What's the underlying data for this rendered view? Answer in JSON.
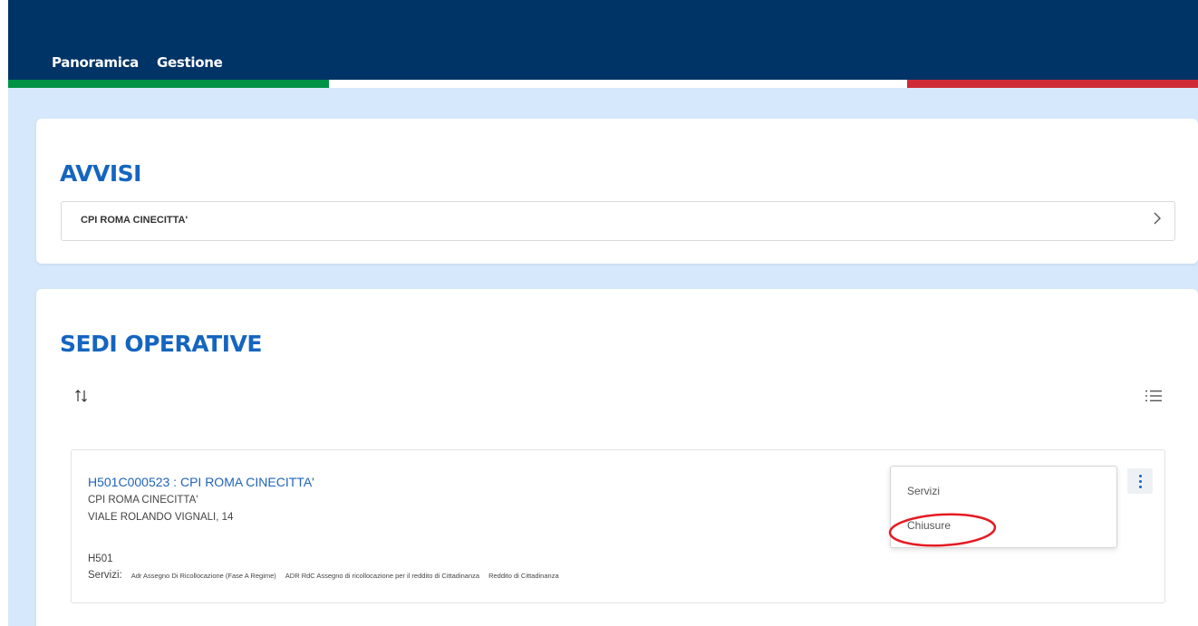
{
  "nav": {
    "items": [
      {
        "label": "Panoramica"
      },
      {
        "label": "Gestione"
      }
    ]
  },
  "colors": {
    "header": "#003366",
    "flag_green": "#009246",
    "flag_white": "#ffffff",
    "flag_red": "#ce2b37",
    "accent": "#1565c0",
    "highlight": "#e41b23"
  },
  "avvisi": {
    "title": "AVVISI",
    "row_label": "CPI ROMA CINECITTA'",
    "row_icon": "chevron-right-icon"
  },
  "sedi": {
    "title": "SEDI OPERATIVE",
    "sort_icon": "sort-icon",
    "view_icon": "list-view-icon",
    "item": {
      "title": "H501C000523 : CPI ROMA CINECITTA'",
      "name": "CPI ROMA CINECITTA'",
      "address": "VIALE ROLANDO VIGNALI, 14",
      "code": "H501",
      "services_label": "Servizi:",
      "services": [
        "Adr Assegno Di Ricollocazione (Fase A Regime)",
        "ADR RdC Assegno di ricollocazione per il reddito di Cittadinanza",
        "Reddito di Cittadinanza"
      ],
      "menu": {
        "items": [
          "Servizi",
          "Chiusure"
        ]
      }
    }
  }
}
